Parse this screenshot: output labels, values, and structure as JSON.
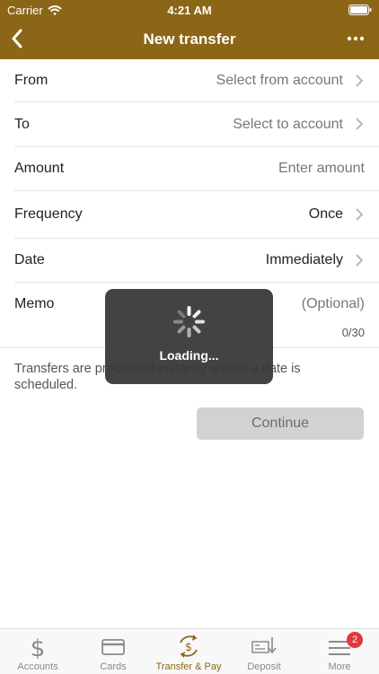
{
  "status_bar": {
    "carrier": "Carrier",
    "time": "4:21 AM"
  },
  "header": {
    "title": "New transfer"
  },
  "form": {
    "from": {
      "label": "From",
      "value": "Select from account"
    },
    "to": {
      "label": "To",
      "value": "Select to account"
    },
    "amount": {
      "label": "Amount",
      "placeholder": "Enter amount"
    },
    "frequency": {
      "label": "Frequency",
      "value": "Once"
    },
    "date": {
      "label": "Date",
      "value": "Immediately"
    },
    "memo": {
      "label": "Memo",
      "placeholder": "(Optional)",
      "counter": "0/30"
    }
  },
  "note": "Transfers are processed instantly unless a date is scheduled.",
  "continue_label": "Continue",
  "loading": {
    "label": "Loading..."
  },
  "tabs": [
    {
      "label": "Accounts",
      "icon": "dollar-icon"
    },
    {
      "label": "Cards",
      "icon": "card-icon"
    },
    {
      "label": "Transfer & Pay",
      "icon": "transfer-pay-icon"
    },
    {
      "label": "Deposit",
      "icon": "deposit-icon"
    },
    {
      "label": "More",
      "icon": "menu-icon",
      "badge": "2"
    }
  ],
  "colors": {
    "brand": "#8b6617",
    "badge": "#e2383d",
    "disabled_button": "#d2d2d2"
  }
}
